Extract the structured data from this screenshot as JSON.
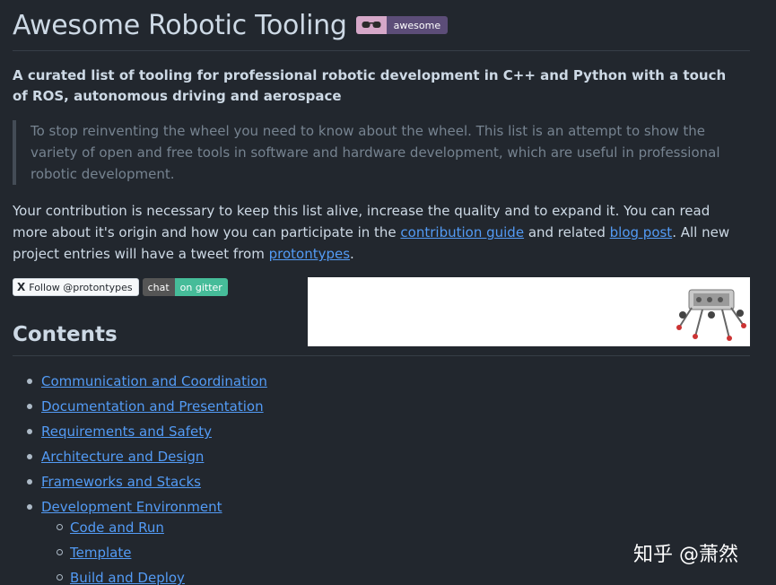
{
  "header": {
    "title": "Awesome Robotic Tooling",
    "badge": {
      "icon": "sunglasses-icon",
      "label": "awesome"
    }
  },
  "subtitle": "A curated list of tooling for professional robotic development in C++ and Python with a touch of ROS, autonomous driving and aerospace",
  "quote": "To stop reinventing the wheel you need to know about the wheel. This list is an attempt to show the variety of open and free tools in software and hardware development, which are useful in professional robotic development.",
  "contribution": {
    "text_1": "Your contribution is necessary to keep this list alive, increase the quality and to expand it. You can read more about it's origin and how you can participate in the ",
    "link_1": "contribution guide",
    "text_2": " and related ",
    "link_2": "blog post",
    "text_3": ". All new project entries will have a tweet from ",
    "link_3": "protontypes",
    "text_4": "."
  },
  "badges": {
    "twitter": {
      "glyph": "X",
      "label": "Follow @protontypes"
    },
    "gitter": {
      "left": "chat",
      "right": "on gitter"
    }
  },
  "contents": {
    "heading": "Contents",
    "items": [
      "Communication and Coordination",
      "Documentation and Presentation",
      "Requirements and Safety",
      "Architecture and Design",
      "Frameworks and Stacks",
      "Development Environment"
    ],
    "sub_items": [
      "Code and Run",
      "Template",
      "Build and Deploy"
    ]
  },
  "watermark": "知乎 @萧然",
  "colors": {
    "background": "#22272e",
    "link": "#539bf5",
    "text": "#cdd9e5",
    "muted": "#768390"
  }
}
